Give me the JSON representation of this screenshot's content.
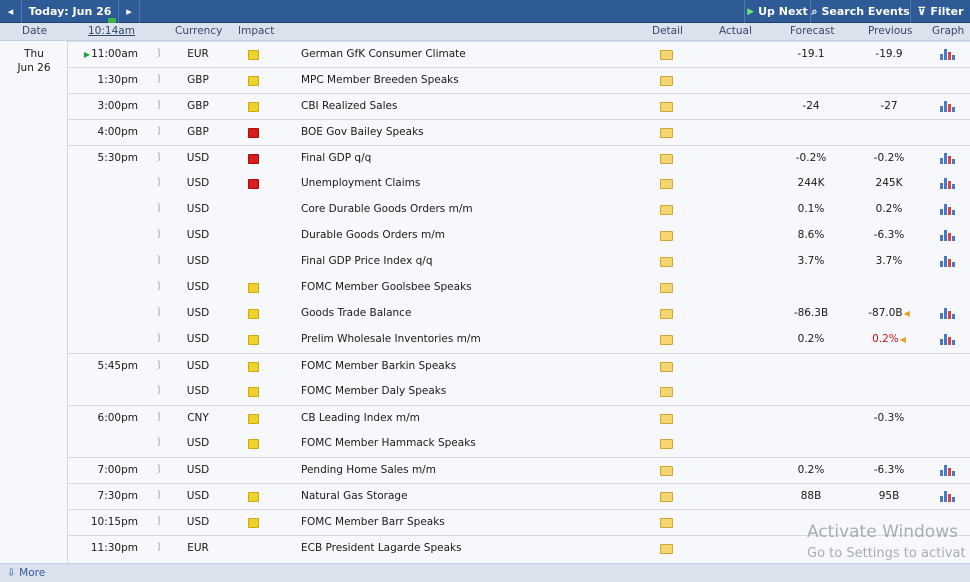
{
  "toolbar": {
    "prev_label": "◂",
    "today_label": "Today: Jun 26",
    "next_label": "▸",
    "up_next_label": "Up Next",
    "search_label": "Search Events",
    "filter_label": "Filter"
  },
  "columns": {
    "date": "Date",
    "time": "10:14am",
    "currency": "Currency",
    "impact": "Impact",
    "detail": "Detail",
    "actual": "Actual",
    "forecast": "Forecast",
    "previous": "Previous",
    "graph": "Graph"
  },
  "day": {
    "weekday": "Thu",
    "date": "Jun 26"
  },
  "colors": {
    "low": "#f0d32a",
    "medium": "#f0902a",
    "high": "#dc1b1b"
  },
  "rows": [
    {
      "time": "11:00am",
      "current": true,
      "currency": "EUR",
      "impact": "low",
      "event": "German GfK Consumer Climate",
      "forecast": "-19.1",
      "previous": "-19.9",
      "graph": true
    },
    {
      "time": "1:30pm",
      "currency": "GBP",
      "impact": "low",
      "event": "MPC Member Breeden Speaks",
      "forecast": "",
      "previous": "",
      "graph": false
    },
    {
      "time": "3:00pm",
      "currency": "GBP",
      "impact": "low",
      "event": "CBI Realized Sales",
      "forecast": "-24",
      "previous": "-27",
      "graph": true
    },
    {
      "time": "4:00pm",
      "currency": "GBP",
      "impact": "high",
      "event": "BOE Gov Bailey Speaks",
      "forecast": "",
      "previous": "",
      "graph": false
    },
    {
      "time": "5:30pm",
      "currency": "USD",
      "impact": "high",
      "event": "Final GDP q/q",
      "forecast": "-0.2%",
      "previous": "-0.2%",
      "graph": true
    },
    {
      "time": "",
      "currency": "USD",
      "impact": "high",
      "event": "Unemployment Claims",
      "forecast": "244K",
      "previous": "245K",
      "graph": true
    },
    {
      "time": "",
      "currency": "USD",
      "impact": "medium",
      "event": "Core Durable Goods Orders m/m",
      "forecast": "0.1%",
      "previous": "0.2%",
      "graph": true
    },
    {
      "time": "",
      "currency": "USD",
      "impact": "medium",
      "event": "Durable Goods Orders m/m",
      "forecast": "8.6%",
      "previous": "-6.3%",
      "graph": true
    },
    {
      "time": "",
      "currency": "USD",
      "impact": "medium",
      "event": "Final GDP Price Index q/q",
      "forecast": "3.7%",
      "previous": "3.7%",
      "graph": true
    },
    {
      "time": "",
      "currency": "USD",
      "impact": "low",
      "event": "FOMC Member Goolsbee Speaks",
      "forecast": "",
      "previous": "",
      "graph": false
    },
    {
      "time": "",
      "currency": "USD",
      "impact": "low",
      "event": "Goods Trade Balance",
      "forecast": "-86.3B",
      "previous": "-87.0B",
      "revised": true,
      "graph": true
    },
    {
      "time": "",
      "currency": "USD",
      "impact": "low",
      "event": "Prelim Wholesale Inventories m/m",
      "forecast": "0.2%",
      "previous": "0.2%",
      "revised": true,
      "previous_red": true,
      "graph": true
    },
    {
      "time": "5:45pm",
      "currency": "USD",
      "impact": "low",
      "event": "FOMC Member Barkin Speaks",
      "forecast": "",
      "previous": "",
      "graph": false
    },
    {
      "time": "",
      "currency": "USD",
      "impact": "low",
      "event": "FOMC Member Daly Speaks",
      "forecast": "",
      "previous": "",
      "graph": false
    },
    {
      "time": "6:00pm",
      "currency": "CNY",
      "impact": "low",
      "event": "CB Leading Index m/m",
      "forecast": "",
      "previous": "-0.3%",
      "graph": false
    },
    {
      "time": "",
      "currency": "USD",
      "impact": "low",
      "event": "FOMC Member Hammack Speaks",
      "forecast": "",
      "previous": "",
      "graph": false
    },
    {
      "time": "7:00pm",
      "currency": "USD",
      "impact": "medium",
      "event": "Pending Home Sales m/m",
      "forecast": "0.2%",
      "previous": "-6.3%",
      "graph": true
    },
    {
      "time": "7:30pm",
      "currency": "USD",
      "impact": "low",
      "event": "Natural Gas Storage",
      "forecast": "88B",
      "previous": "95B",
      "graph": true
    },
    {
      "time": "10:15pm",
      "currency": "USD",
      "impact": "low",
      "event": "FOMC Member Barr Speaks",
      "forecast": "",
      "previous": "",
      "graph": false
    },
    {
      "time": "11:30pm",
      "currency": "EUR",
      "impact": "medium",
      "event": "ECB President Lagarde Speaks",
      "forecast": "",
      "previous": "",
      "graph": false
    }
  ],
  "footer": {
    "more_label": "More"
  },
  "watermark": {
    "line1": "Activate Windows",
    "line2": "Go to Settings to activat"
  }
}
